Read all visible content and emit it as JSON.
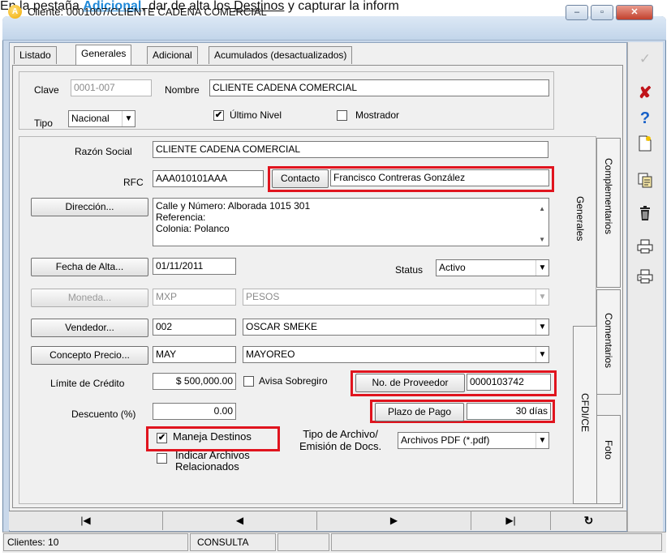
{
  "instruction_strip": {
    "prefix": "En la pestaña ",
    "tab_name": "Adicional",
    "middle": ", dar de alta los ",
    "link": "Destinos",
    "suffix": " y capturar la inform"
  },
  "window": {
    "title": "Cliente: 0001007/CLIENTE CADENA COMERCIAL",
    "app_icon_letter": "A",
    "minimize": "–",
    "maximize": "▫",
    "close": "✕"
  },
  "tabs": [
    {
      "label": "Listado"
    },
    {
      "label": "Generales"
    },
    {
      "label": "Adicional"
    },
    {
      "label": "Acumulados (desactualizados)"
    }
  ],
  "header": {
    "clave_label": "Clave",
    "clave_value": "0001-007",
    "nombre_label": "Nombre",
    "nombre_value": "CLIENTE CADENA COMERCIAL",
    "tipo_label": "Tipo",
    "tipo_value": "Nacional",
    "ultimo_nivel_label": "Último Nivel",
    "ultimo_nivel_checked": true,
    "mostrador_label": "Mostrador",
    "mostrador_checked": false
  },
  "form": {
    "razon_social_label": "Razón Social",
    "razon_social_value": "CLIENTE CADENA COMERCIAL",
    "rfc_label": "RFC",
    "rfc_value": "AAA010101AAA",
    "contacto_label": "Contacto",
    "contacto_value": "Francisco Contreras González",
    "direccion_button": "Dirección...",
    "direccion_line1": "Calle y Número: Alborada  1015  301",
    "direccion_line2": "Referencia:",
    "direccion_line3": "Colonia: Polanco",
    "fecha_alta_button": "Fecha de Alta...",
    "fecha_alta_value": "01/11/2011",
    "status_label": "Status",
    "status_value": "Activo",
    "moneda_button": "Moneda...",
    "moneda_code": "MXP",
    "moneda_name": "PESOS",
    "vendedor_button": "Vendedor...",
    "vendedor_code": "002",
    "vendedor_name": "OSCAR SMEKE",
    "concepto_precio_button": "Concepto Precio...",
    "concepto_code": "MAY",
    "concepto_name": "MAYOREO",
    "limite_credito_label": "Límite de Crédito",
    "limite_credito_value": "$ 500,000.00",
    "avisa_sobregiro_label": "Avisa Sobregiro",
    "avisa_sobregiro_checked": false,
    "no_proveedor_label": "No. de Proveedor",
    "no_proveedor_value": "0000103742",
    "descuento_label": "Descuento (%)",
    "descuento_value": "0.00",
    "plazo_pago_label": "Plazo de Pago",
    "plazo_pago_value": "30 días",
    "maneja_destinos_label": "Maneja Destinos",
    "maneja_destinos_checked": true,
    "indicar_archivos_label_1": "Indicar Archivos",
    "indicar_archivos_label_2": "Relacionados",
    "tipo_archivo_label_1": "Tipo de Archivo/",
    "tipo_archivo_label_2": "Emisión de Docs.",
    "tipo_archivo_value": "Archivos PDF (*.pdf)"
  },
  "vertical_tabs": {
    "generales": "Generales",
    "complementarios": "Complementarios",
    "comentarios": "Comentarios",
    "cfdi_ce": "CFDI/CE",
    "foto": "Foto"
  },
  "sidebar_icons": [
    "checkmark-icon",
    "delete-x-icon",
    "help-icon",
    "new-document-icon",
    "copy-document-icon",
    "trash-icon",
    "print-icon",
    "print-preview-icon"
  ],
  "navigation": {
    "first": "|◀",
    "prev": "◀",
    "next": "▶",
    "last": "▶|",
    "refresh": "↻"
  },
  "status": {
    "count": "Clientes: 10",
    "mode": "CONSULTA"
  },
  "colors": {
    "highlight_box": "#e0141e",
    "title_bg": "#c9d8ea",
    "delete_icon": "#c0141a",
    "help_icon": "#1660c8"
  }
}
